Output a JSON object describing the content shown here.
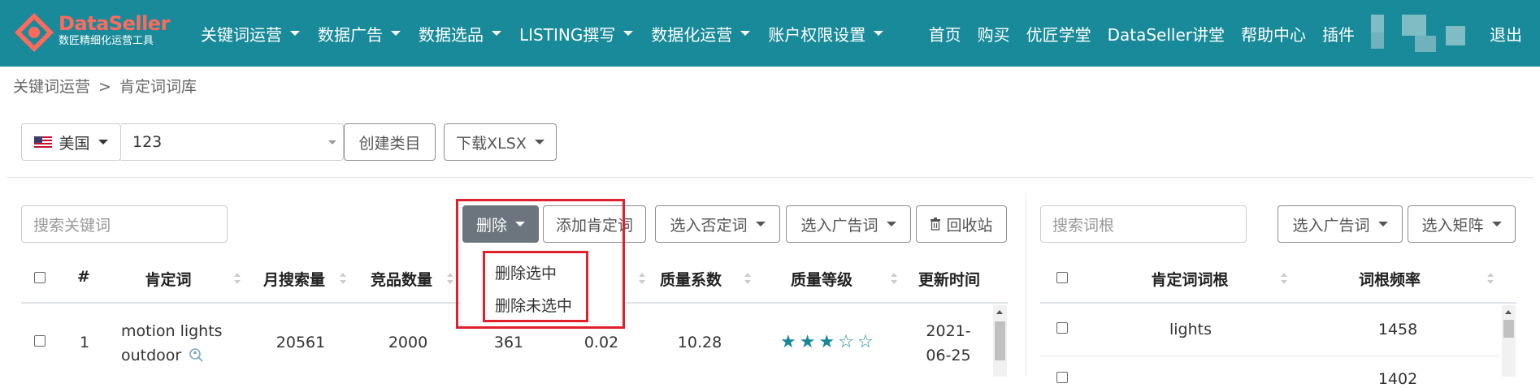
{
  "nav": {
    "brand_name": "DataSeller",
    "brand_sub": "数匠精细化运营工具",
    "menu": [
      "关键词运营",
      "数据广告",
      "数据选品",
      "LISTING撰写",
      "数据化运营",
      "账户权限设置"
    ],
    "right": [
      "首页",
      "购买",
      "优匠学堂",
      "DataSeller讲堂",
      "帮助中心",
      "插件"
    ],
    "logout": "退出"
  },
  "breadcrumb": {
    "parent": "关键词运营",
    "sep": ">",
    "current": "肯定词词库"
  },
  "toolbar": {
    "country": "美国",
    "category_value": "123",
    "create_category": "创建类目",
    "download": "下载XLSX"
  },
  "left": {
    "search_placeholder": "搜索关键词",
    "delete": "删除",
    "add_positive": "添加肯定词",
    "select_negative": "选入否定词",
    "select_ad": "选入广告词",
    "recycle": "回收站",
    "dropdown": [
      "删除选中",
      "删除未选中"
    ],
    "headers": [
      "#",
      "肯定词",
      "月搜索量",
      "竞品数量",
      "质量系数",
      "质量等级",
      "更新时间"
    ],
    "rows": [
      {
        "index": "1",
        "keyword_line1": "motion lights",
        "keyword_line2": "outdoor",
        "monthly_search": "20561",
        "competitors": "2000",
        "col_a": "361",
        "col_b": "0.02",
        "quality": "10.28",
        "stars_filled": 3,
        "stars_total": 5,
        "date_line1": "2021-",
        "date_line2": "06-25"
      }
    ]
  },
  "right": {
    "search_placeholder": "搜索词根",
    "select_ad": "选入广告词",
    "select_matrix": "选入矩阵",
    "headers": [
      "肯定词词根",
      "词根频率"
    ],
    "rows": [
      {
        "root": "lights",
        "freq": "1458"
      },
      {
        "root": "",
        "freq": "1402"
      }
    ]
  },
  "colors": {
    "nav_bg": "#188a99",
    "accent": "#17879a",
    "highlight": "#e0202a",
    "brand": "#ff6a5c"
  }
}
